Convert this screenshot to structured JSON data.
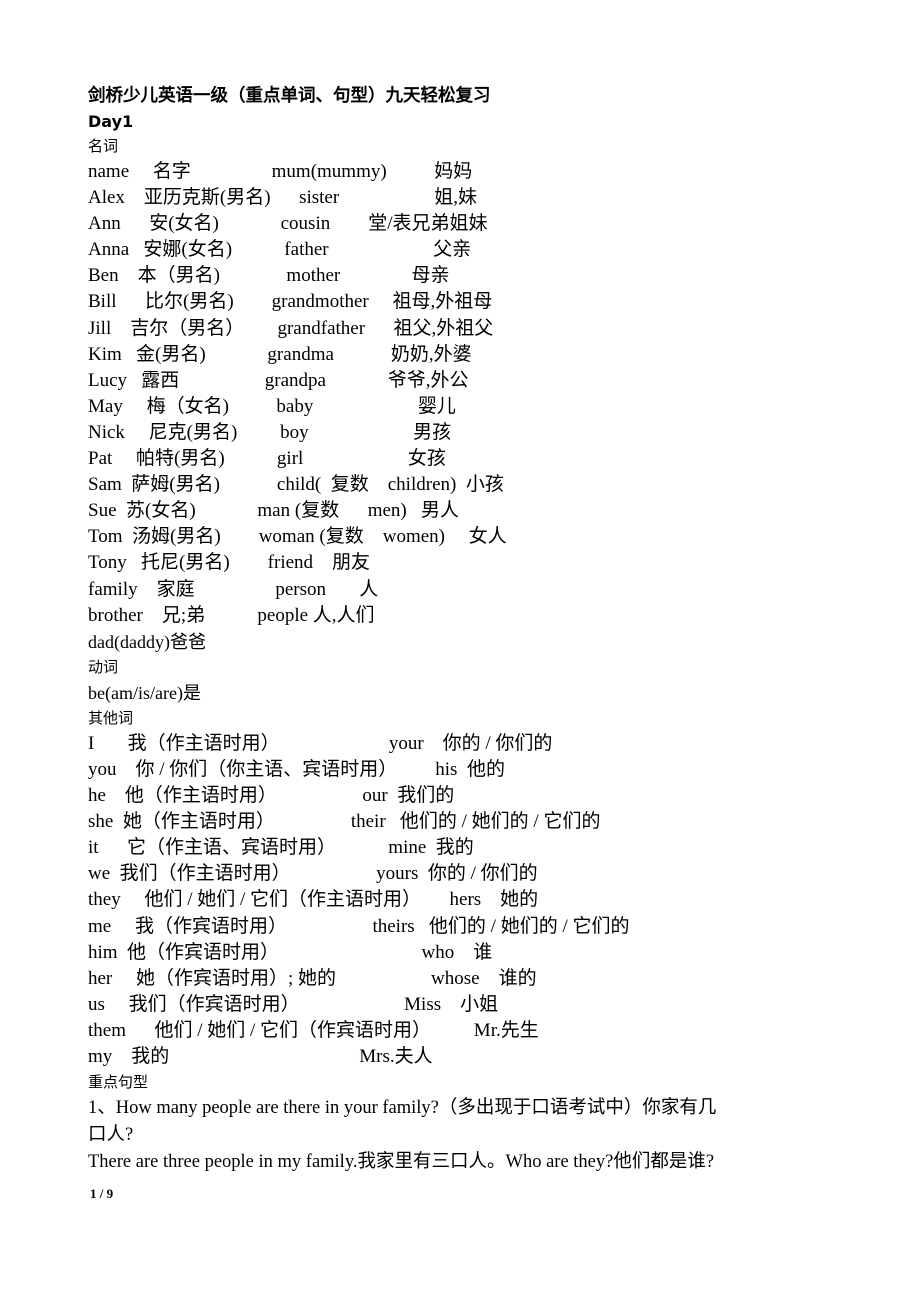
{
  "document": {
    "title": "剑桥少儿英语一级（重点单词、句型）九天轻松复习",
    "day_heading": "Day1",
    "page_number": "1 / 9"
  },
  "sections": {
    "nouns_heading": "名词",
    "verbs_heading": "动词",
    "others_heading": "其他词",
    "sentences_heading": "重点句型"
  },
  "noun_lines": [
    "name     名字                 mum(mummy)          妈妈",
    "Alex    亚历克斯(男名)      sister                    姐,妹",
    "Ann      安(女名)             cousin        堂/表兄弟姐妹",
    "Anna   安娜(女名)           father                      父亲",
    "Ben    本（男名)              mother               母亲",
    "Bill      比尔(男名)        grandmother     祖母,外祖母",
    "Jill    吉尔（男名）       grandfather      祖父,外祖父",
    "Kim   金(男名)             grandma            奶奶,外婆",
    "Lucy   露西                  grandpa             爷爷,外公",
    "May     梅（女名)          baby                      婴儿",
    "Nick     尼克(男名)         boy                      男孩",
    "Pat     帕特(男名)           girl                      女孩",
    "Sam  萨姆(男名)            child(  复数    children)  小孩",
    "Sue  苏(女名)             man (复数      men)   男人",
    "Tom  汤姆(男名)        woman (复数    women)     女人",
    "Tony   托尼(男名)        friend    朋友",
    "family    家庭                 person       人",
    "brother    兄;弟           people 人,人们"
  ],
  "noun_last_line": "dad(daddy)爸爸",
  "verb_lines": [
    "be(am/is/are)是"
  ],
  "other_lines": [
    "I       我（作主语时用）                       your    你的 / 你们的",
    "you    你 / 你们（你主语、宾语时用）        his  他的",
    "he    他（作主语时用）                  our  我们的",
    "she  她（作主语时用）                their   他们的 / 她们的 / 它们的",
    "it      它（作主语、宾语时用）           mine  我的",
    "we  我们（作主语时用）                  yours  你的 / 你们的",
    "they     他们 / 她们 / 它们（作主语时用）      hers    她的",
    "me     我（作宾语时用）                  theirs   他们的 / 她们的 / 它们的",
    "him  他（作宾语时用）                              who    谁",
    "her     她（作宾语时用）; 她的                    whose    谁的",
    "us     我们（作宾语时用）                      Miss    小姐",
    "them      他们 / 她们 / 它们（作宾语时用）         Mr.先生",
    "my    我的                                        Mrs.夫人"
  ],
  "sentence_lines": [
    "1、How many people are there in your family?（多出现于口语考试中）你家有几",
    "口人?",
    "There are three people in my family.我家里有三口人。Who are they?他们都是谁?"
  ]
}
